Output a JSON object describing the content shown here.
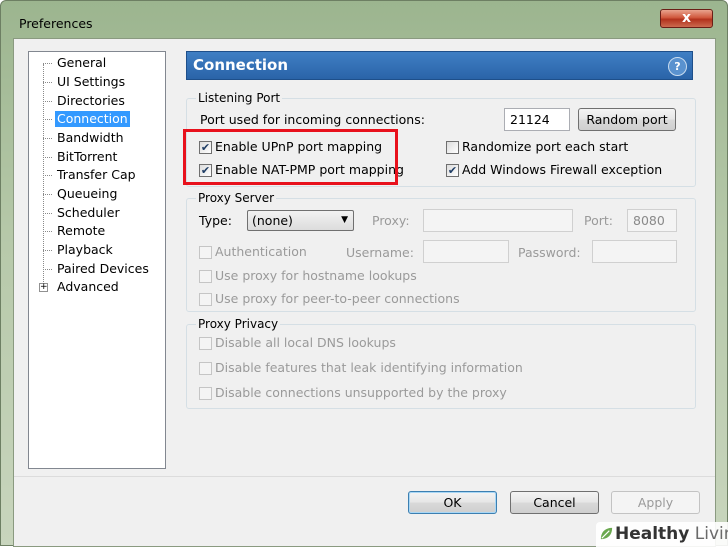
{
  "window": {
    "title": "Preferences",
    "close_glyph": "x"
  },
  "sidebar": {
    "items": [
      {
        "label": "General"
      },
      {
        "label": "UI Settings"
      },
      {
        "label": "Directories"
      },
      {
        "label": "Connection",
        "selected": true
      },
      {
        "label": "Bandwidth"
      },
      {
        "label": "BitTorrent"
      },
      {
        "label": "Transfer Cap"
      },
      {
        "label": "Queueing"
      },
      {
        "label": "Scheduler"
      },
      {
        "label": "Remote"
      },
      {
        "label": "Playback"
      },
      {
        "label": "Paired Devices"
      },
      {
        "label": "Advanced",
        "expandable": true
      }
    ],
    "expander_glyph": "+"
  },
  "panel": {
    "title": "Connection",
    "help_glyph": "?"
  },
  "listening_port": {
    "group_label": "Listening Port",
    "port_label": "Port used for incoming connections:",
    "port_value": "21124",
    "random_port_button": "Random port",
    "upnp": {
      "label": "Enable UPnP port mapping",
      "checked": true
    },
    "natpmp": {
      "label": "Enable NAT-PMP port mapping",
      "checked": true
    },
    "randomize": {
      "label": "Randomize port each start",
      "checked": false
    },
    "firewall": {
      "label": "Add Windows Firewall exception",
      "checked": true
    }
  },
  "proxy_server": {
    "group_label": "Proxy Server",
    "type_label": "Type:",
    "type_value": "(none)",
    "proxy_label": "Proxy:",
    "proxy_value": "",
    "port_label": "Port:",
    "port_value": "8080",
    "authentication": {
      "label": "Authentication",
      "checked": false
    },
    "username_label": "Username:",
    "password_label": "Password:",
    "hostname_lookups": {
      "label": "Use proxy for hostname lookups",
      "checked": false
    },
    "peer_connections": {
      "label": "Use proxy for peer-to-peer connections",
      "checked": false
    }
  },
  "proxy_privacy": {
    "group_label": "Proxy Privacy",
    "dns": {
      "label": "Disable all local DNS lookups",
      "checked": false
    },
    "leak": {
      "label": "Disable features that leak identifying information",
      "checked": false
    },
    "unsupported": {
      "label": "Disable connections unsupported by the proxy",
      "checked": false
    }
  },
  "footer": {
    "ok": "OK",
    "cancel": "Cancel",
    "apply": "Apply"
  },
  "watermark": {
    "brand": "Healthy",
    "suffix": "Living"
  },
  "colors": {
    "highlight_box": "#e8111c",
    "header_blue": "#2a64a8",
    "selection": "#3399ff"
  }
}
